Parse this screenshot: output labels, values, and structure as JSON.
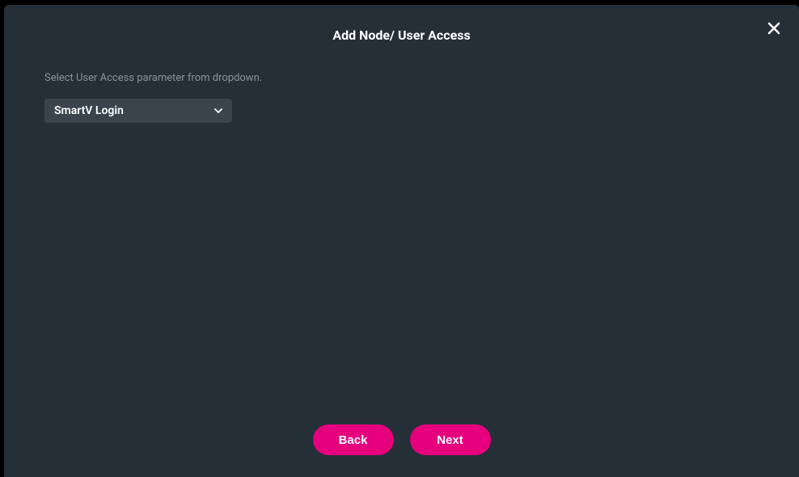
{
  "modal": {
    "title": "Add Node/ User Access",
    "instruction": "Select User Access parameter from dropdown.",
    "dropdown": {
      "selected": "SmartV Login"
    },
    "buttons": {
      "back": "Back",
      "next": "Next"
    }
  }
}
